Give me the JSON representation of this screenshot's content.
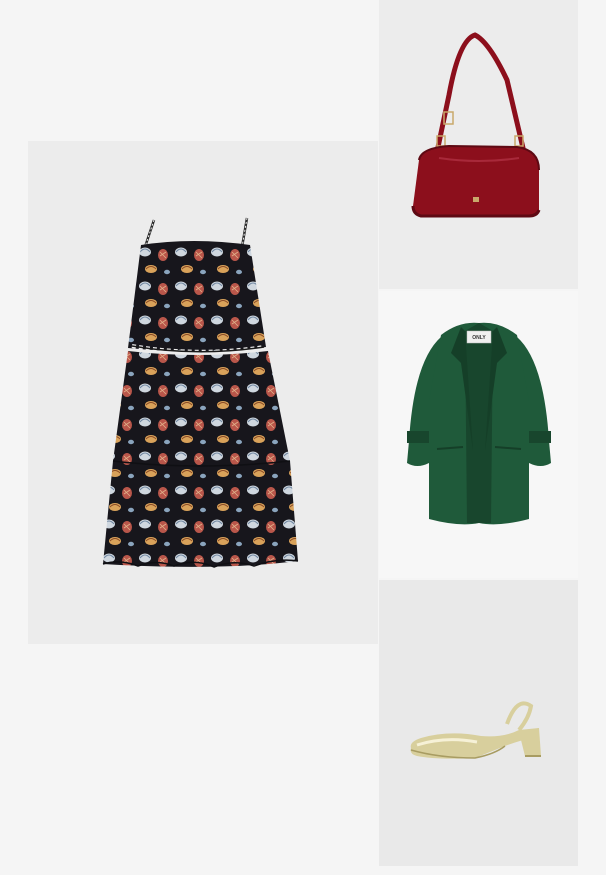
{
  "collage": {
    "items": [
      {
        "id": "dress",
        "icon": "sundress-image",
        "colors": {
          "fabric": "#17161c",
          "accent1": "#b9564a",
          "accent2": "#cfd7df",
          "accent3": "#d9a25a"
        }
      },
      {
        "id": "bag",
        "icon": "handbag-image",
        "colors": {
          "body": "#8c0f1c",
          "shadow": "#5e0913",
          "hardware": "#c9a96b"
        }
      },
      {
        "id": "blazer",
        "icon": "blazer-image",
        "label_text": "ONLY",
        "colors": {
          "fabric": "#1f5a3a",
          "shadow": "#153f28",
          "lining": "#18462d"
        }
      },
      {
        "id": "shoe",
        "icon": "slingback-image",
        "colors": {
          "metal": "#d8cf9d",
          "highlight": "#f6f1d7",
          "shadow": "#a89c62"
        }
      }
    ]
  }
}
